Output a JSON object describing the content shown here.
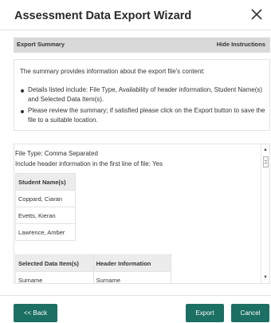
{
  "dialog": {
    "title": "Assessment Data Export Wizard",
    "close_icon": "close-icon"
  },
  "section": {
    "title": "Export Summary",
    "hide_instructions": "Hide Instructions"
  },
  "instructions": {
    "intro": "The summary provides information about the export file's content:",
    "bullets": [
      "Details listed include: File Type, Availability of header information, Student Name(s) and Selected Data Item(s).",
      "Please review the summary; if satisfied please click on the Export button to save the file to a suitable location."
    ]
  },
  "summary": {
    "file_type": "File Type: Comma Separated",
    "header_info": "Include header information in the first line of file: Yes",
    "students_header": "Student Name(s)",
    "students": [
      "Coppard, Ciaran",
      "Evetts, Kieran",
      "Lawrence, Amber"
    ],
    "data_items_headers": [
      "Selected Data Item(s)",
      "Header Information"
    ],
    "data_items": [
      [
        "Surname",
        "Surname"
      ]
    ]
  },
  "buttons": {
    "back": "<< Back",
    "export": "Export",
    "cancel": "Cancel"
  },
  "colors": {
    "primary_button": "#1b6f63",
    "section_bar": "#d9d9d9",
    "table_header": "#ececec"
  }
}
